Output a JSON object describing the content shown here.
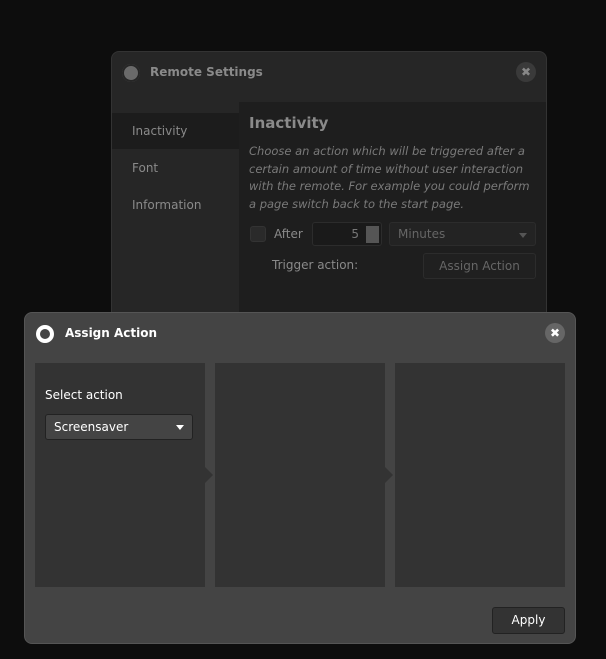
{
  "remote_settings": {
    "title": "Remote Settings",
    "nav": [
      {
        "label": "Inactivity",
        "active": true
      },
      {
        "label": "Font"
      },
      {
        "label": "Information"
      }
    ],
    "heading": "Inactivity",
    "description": "Choose an action which will be triggered after a certain amount of time without user interaction with the remote. For example you could perform a page switch back to the start page.",
    "after_label": "After",
    "after_checked": false,
    "after_value": "5",
    "unit_selected": "Minutes",
    "trigger_label": "Trigger action:",
    "assign_button": "Assign Action"
  },
  "assign_action": {
    "title": "Assign Action",
    "select_label": "Select action",
    "selected_action": "Screensaver",
    "apply_button": "Apply"
  },
  "icons": {
    "title": "gear-icon",
    "close": "close-icon"
  }
}
